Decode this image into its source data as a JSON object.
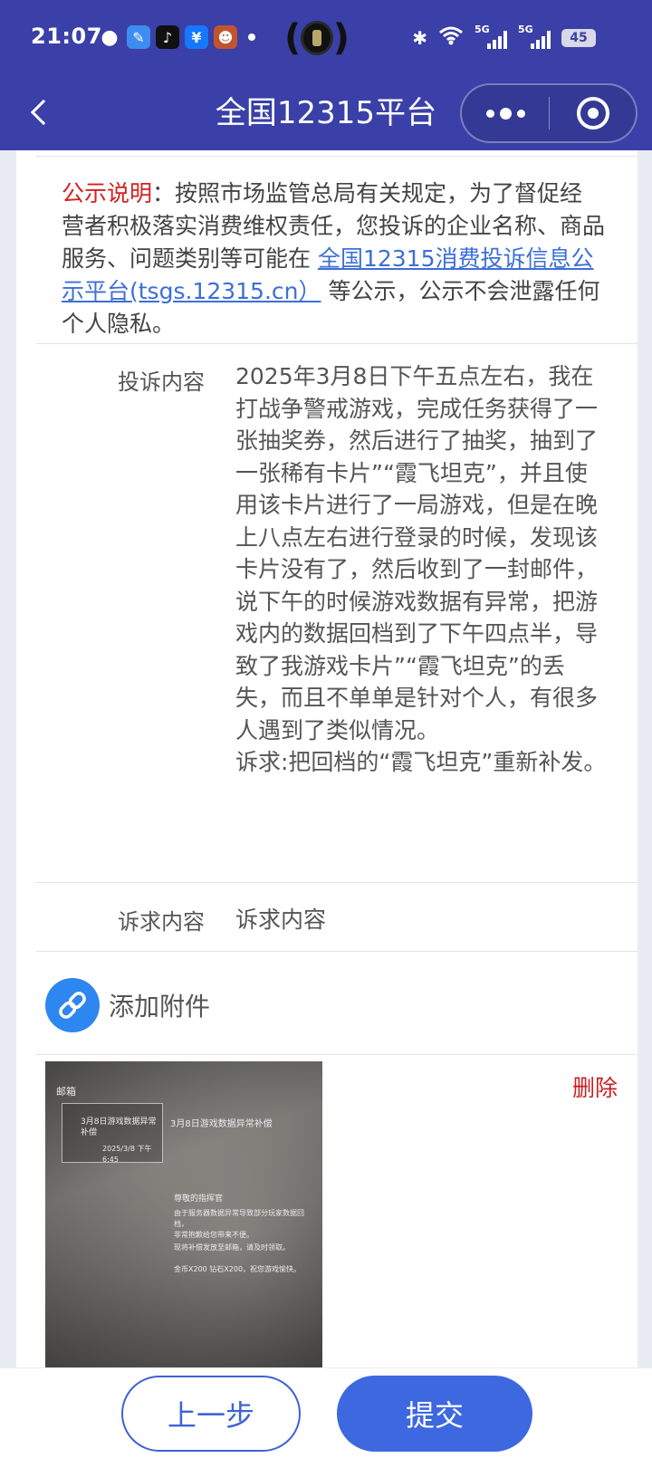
{
  "status_bar": {
    "time": "21:07",
    "battery": "45",
    "network_labels": [
      "5G",
      "5G"
    ]
  },
  "nav": {
    "title": "全国12315平台"
  },
  "notice": {
    "title": "公示说明",
    "text_before_link": "：按照市场监管总局有关规定，为了督促经营者积极落实消费维权责任，您投诉的企业名称、商品服务、问题类别等可能在 ",
    "link_text": "全国12315消费投诉信息公示平台(tsgs.12315.cn）",
    "text_after_link": " 等公示，公示不会泄露任何个人隐私。"
  },
  "complaint": {
    "label": "投诉内容",
    "value": "2025年3月8日下午五点左右，我在打战争警戒游戏，完成任务获得了一张抽奖券，然后进行了抽奖，抽到了一张稀有卡片”“霞飞坦克”，并且使用该卡片进行了一局游戏，但是在晚上八点左右进行登录的时候，发现该卡片没有了，然后收到了一封邮件，说下午的时候游戏数据有异常，把游戏内的数据回档到了下午四点半，导致了我游戏卡片”“霞飞坦克”的丢失，而且不单单是针对个人，有很多人遇到了类似情况。\n诉求:把回档的“霞飞坦克”重新补发。"
  },
  "demand": {
    "label": "诉求内容",
    "value": "诉求内容"
  },
  "attachment": {
    "label": "添加附件",
    "delete_label": "删除"
  },
  "thumbnail_text": {
    "back": "邮箱",
    "panel_title": "3月8日游戏数据异常补偿",
    "panel_date": "2025/3/8 下午6:45",
    "mail_title": "3月8日游戏数据异常补偿",
    "body_title": "尊敬的指挥官",
    "body_lines": [
      "由于服务器数据异常导致部分玩家数据回档，",
      "非常抱歉给您带来不便。",
      "现将补偿发放至邮箱，请及时领取。",
      "金币X200 钻石X200，祝您游戏愉快。"
    ]
  },
  "bottom": {
    "prev_label": "上一步",
    "submit_label": "提交"
  }
}
